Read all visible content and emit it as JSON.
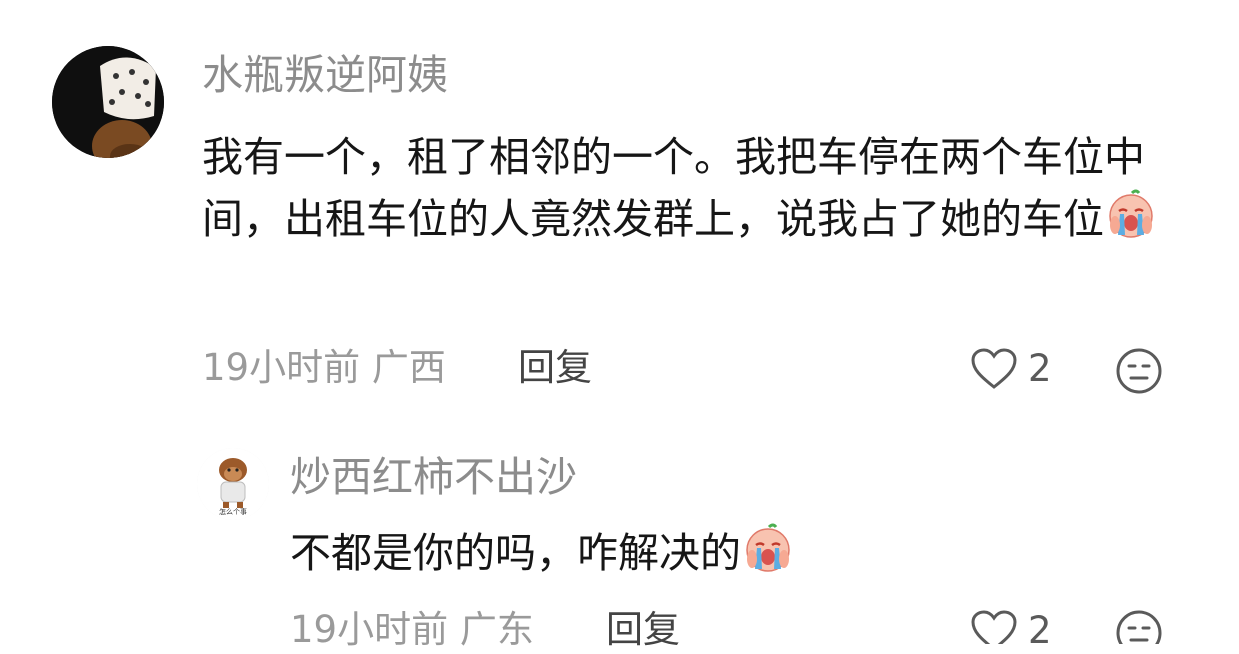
{
  "comments": [
    {
      "username": "水瓶叛逆阿姨",
      "text": "我有一个，租了相邻的一个。我把车停在两个车位中间，出租车位的人竟然发群上，说我占了她的车位",
      "emoji": "crying-face-emoji",
      "time_location": "19小时前 广西",
      "reply_label": "回复",
      "likes": "2"
    },
    {
      "username": "炒西红柿不出沙",
      "text": "不都是你的吗，咋解决的",
      "emoji": "crying-face-emoji",
      "avatar_caption": "怎么个事",
      "time_location": "19小时前 广东",
      "reply_label": "回复",
      "likes": "2"
    }
  ]
}
